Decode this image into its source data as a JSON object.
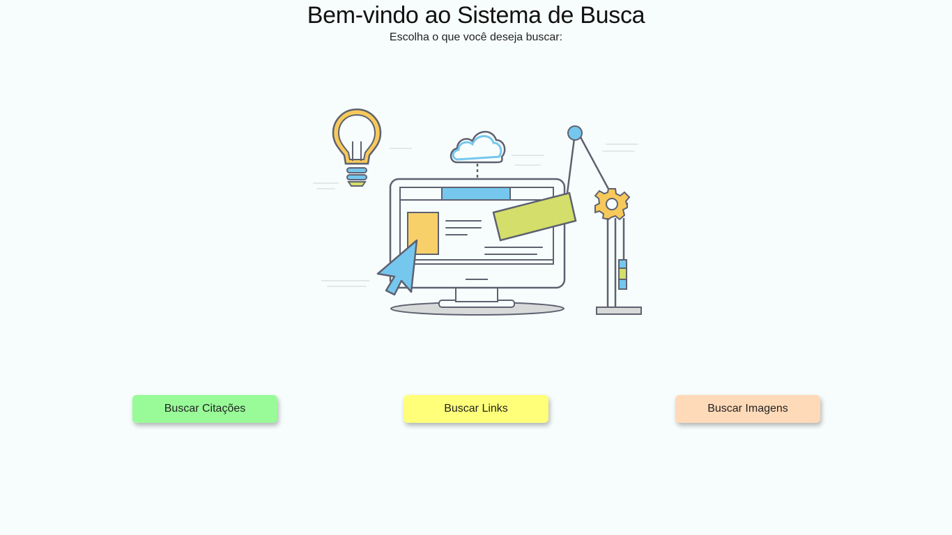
{
  "header": {
    "title": "Bem-vindo ao Sistema de Busca",
    "subtitle": "Escolha o que você deseja buscar:"
  },
  "illustration": {
    "icons": [
      "lightbulb-icon",
      "cloud-icon",
      "monitor-icon",
      "cursor-arrow-icon",
      "gear-icon"
    ]
  },
  "actions": {
    "quotes_label": "Buscar Citações",
    "links_label": "Buscar Links",
    "images_label": "Buscar Imagens"
  },
  "colors": {
    "background": "#f7fdfc",
    "quotes_button": "#98fb98",
    "links_button": "#ffff7a",
    "images_button": "#ffdab9"
  }
}
